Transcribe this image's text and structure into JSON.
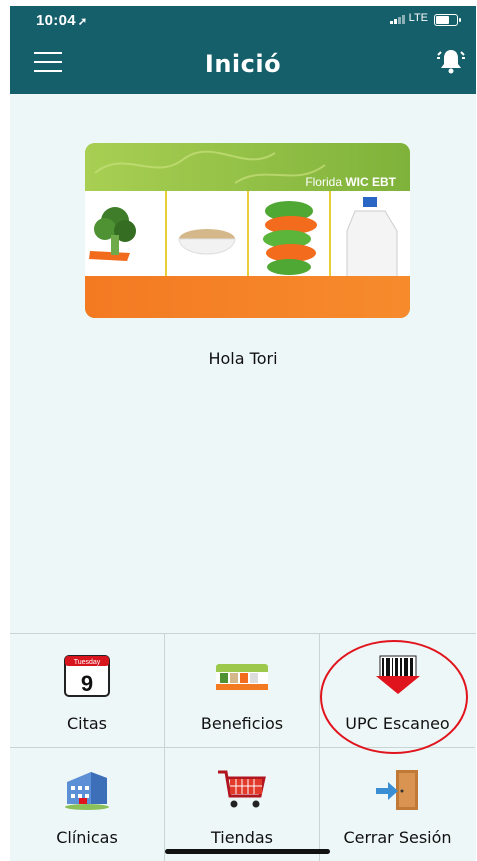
{
  "status_bar": {
    "time": "10:04",
    "carrier": "LTE"
  },
  "header": {
    "title": "Inició"
  },
  "card": {
    "label_prefix": "Florida ",
    "label_brand": "WIC EBT"
  },
  "greeting": "Hola Tori",
  "grid": [
    {
      "label": "Citas",
      "icon": "calendar-icon",
      "calendar_day": "Tuesday",
      "calendar_date": "9"
    },
    {
      "label": "Beneficios",
      "icon": "benefits-card-icon"
    },
    {
      "label": "UPC Escaneo",
      "icon": "barcode-scan-icon"
    },
    {
      "label": "Clínicas",
      "icon": "clinic-building-icon"
    },
    {
      "label": "Tiendas",
      "icon": "shopping-cart-icon"
    },
    {
      "label": "Cerrar Sesión",
      "icon": "logout-door-icon"
    }
  ],
  "colors": {
    "header": "#155f6b",
    "background": "#eef7f7",
    "highlight_circle": "#e0141d"
  }
}
